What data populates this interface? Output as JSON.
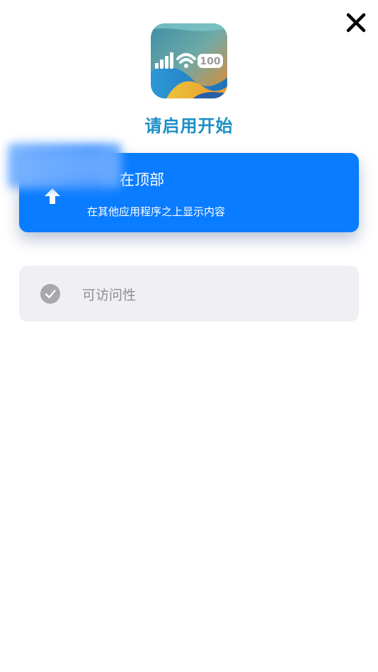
{
  "header": {
    "title": "请启用开始"
  },
  "app_icon": {
    "badge_text": "100"
  },
  "options": {
    "on_top": {
      "heading": "在顶部",
      "subtitle": "在其他应用程序之上显示内容"
    },
    "accessibility": {
      "label": "可访问性"
    }
  },
  "icons": {
    "close": "close-icon",
    "arrow": "arrow-up-icon",
    "check": "checkmark-circle-icon"
  },
  "colors": {
    "title": "#1b8fc4",
    "primary_card": "#0a7cff",
    "secondary_card": "#efeff4",
    "secondary_text": "#8e8e93"
  }
}
